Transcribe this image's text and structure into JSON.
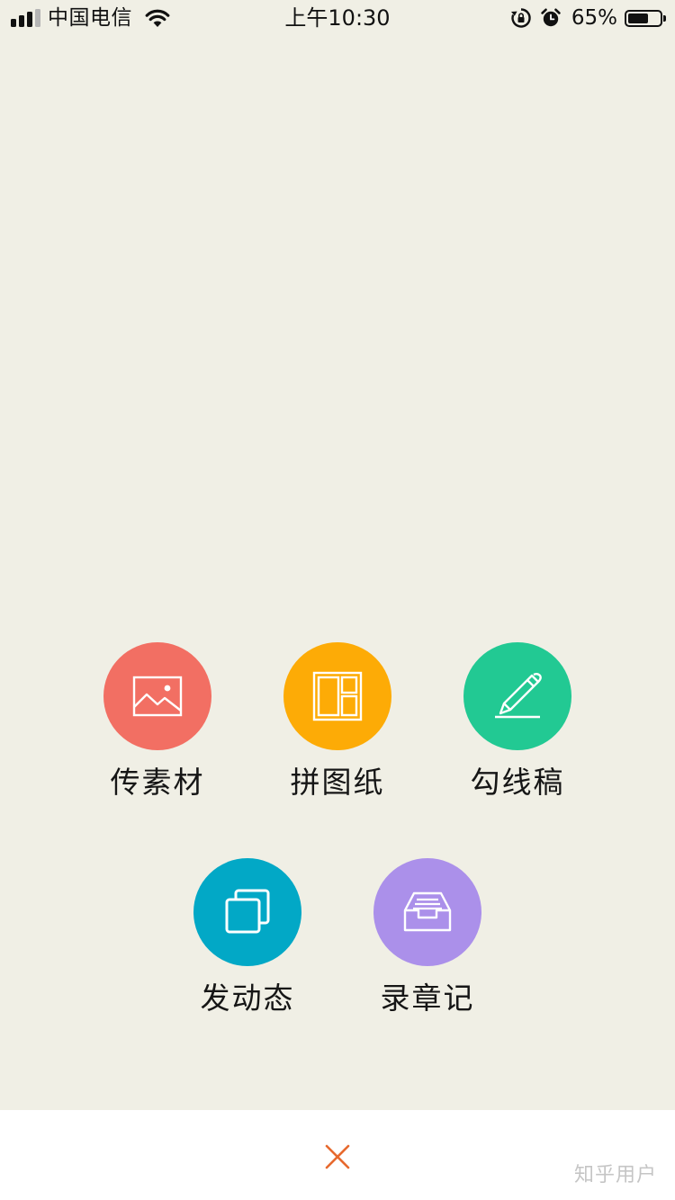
{
  "status_bar": {
    "carrier": "中国电信",
    "time": "上午10:30",
    "battery_percent": "65%",
    "battery_level": 0.65,
    "icons": [
      "signal-icon",
      "wifi-icon",
      "rotation-lock-icon",
      "alarm-icon",
      "battery-icon"
    ]
  },
  "actions": [
    {
      "label": "传素材",
      "color": "#f26f63",
      "icon": "image-icon"
    },
    {
      "label": "拼图纸",
      "color": "#fdab06",
      "icon": "collage-layout-icon"
    },
    {
      "label": "勾线稿",
      "color": "#22c993",
      "icon": "pen-icon"
    },
    {
      "label": "发动态",
      "color": "#02a8c6",
      "icon": "copy-stack-icon"
    },
    {
      "label": "录章记",
      "color": "#ab90ea",
      "icon": "inbox-tray-icon"
    }
  ],
  "bottom_bar": {
    "close_icon": "close-icon",
    "close_color": "#e7692e"
  },
  "watermark": "知乎用户"
}
